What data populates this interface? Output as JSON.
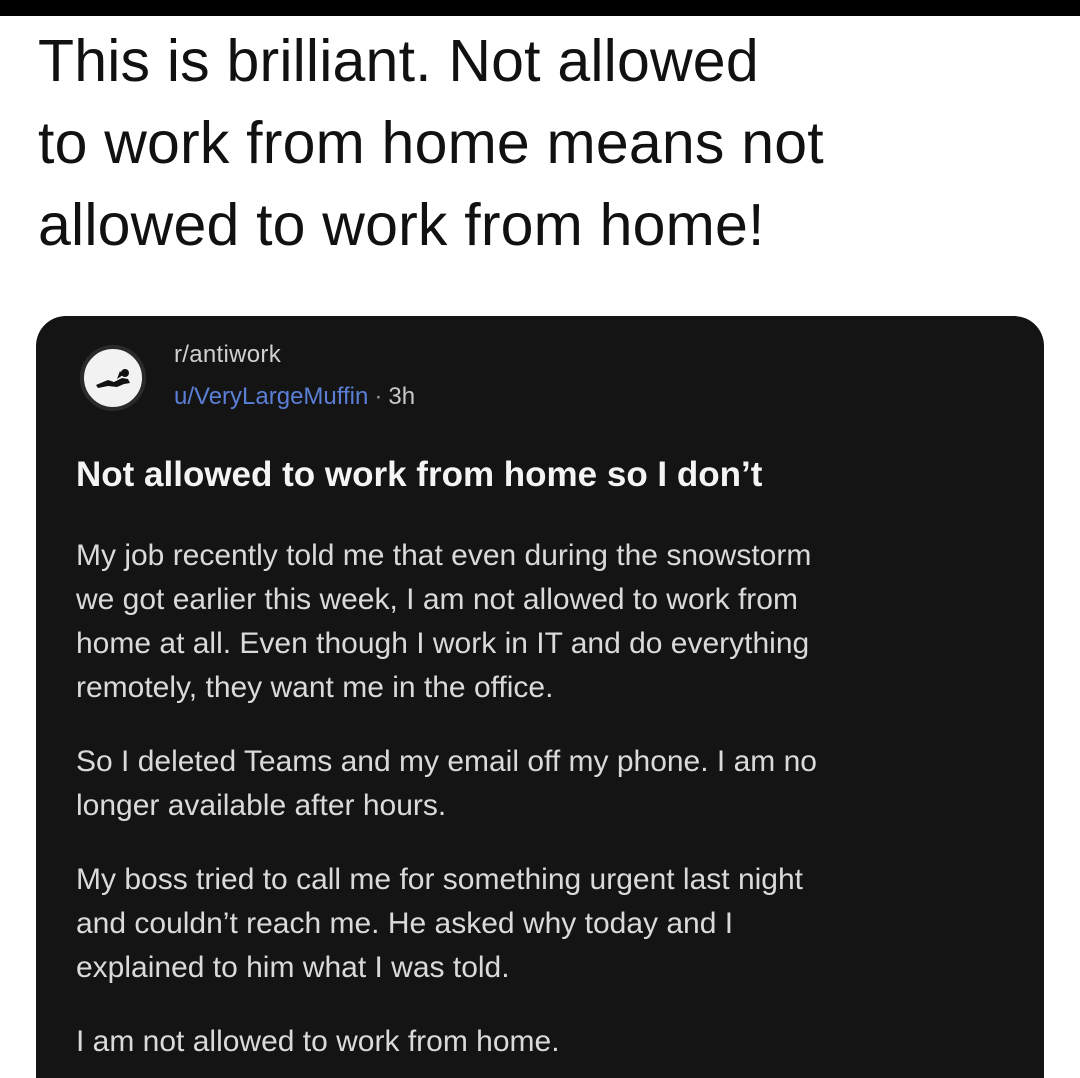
{
  "tweet": {
    "text": "This is brilliant. Not allowed\nto work from home means not\nallowed to work from home!"
  },
  "reddit_post": {
    "subreddit": "r/antiwork",
    "username": "u/VeryLargeMuffin",
    "separator": "·",
    "age": "3h",
    "title": "Not allowed to work from home so I don’t",
    "paragraphs": [
      "My job recently told me that even during the snowstorm\nwe got earlier this week, I am not allowed to work from\nhome at all. Even though I work in IT and do everything\nremotely, they want me in the office.",
      "So I deleted Teams and my email off my phone. I am no\nlonger available after hours.",
      "My boss tried to call me for something urgent last night\nand couldn’t reach me. He asked why today and I\nexplained to him what I was told.",
      "I am not allowed to work from home."
    ]
  },
  "colors": {
    "page_background": "#ffffff",
    "card_background": "#141414",
    "username": "#5b7fd6",
    "title_text": "#f4f4f4",
    "body_text": "#dadada"
  },
  "icons": {
    "avatar": "antiwork-subreddit-avatar-icon"
  }
}
